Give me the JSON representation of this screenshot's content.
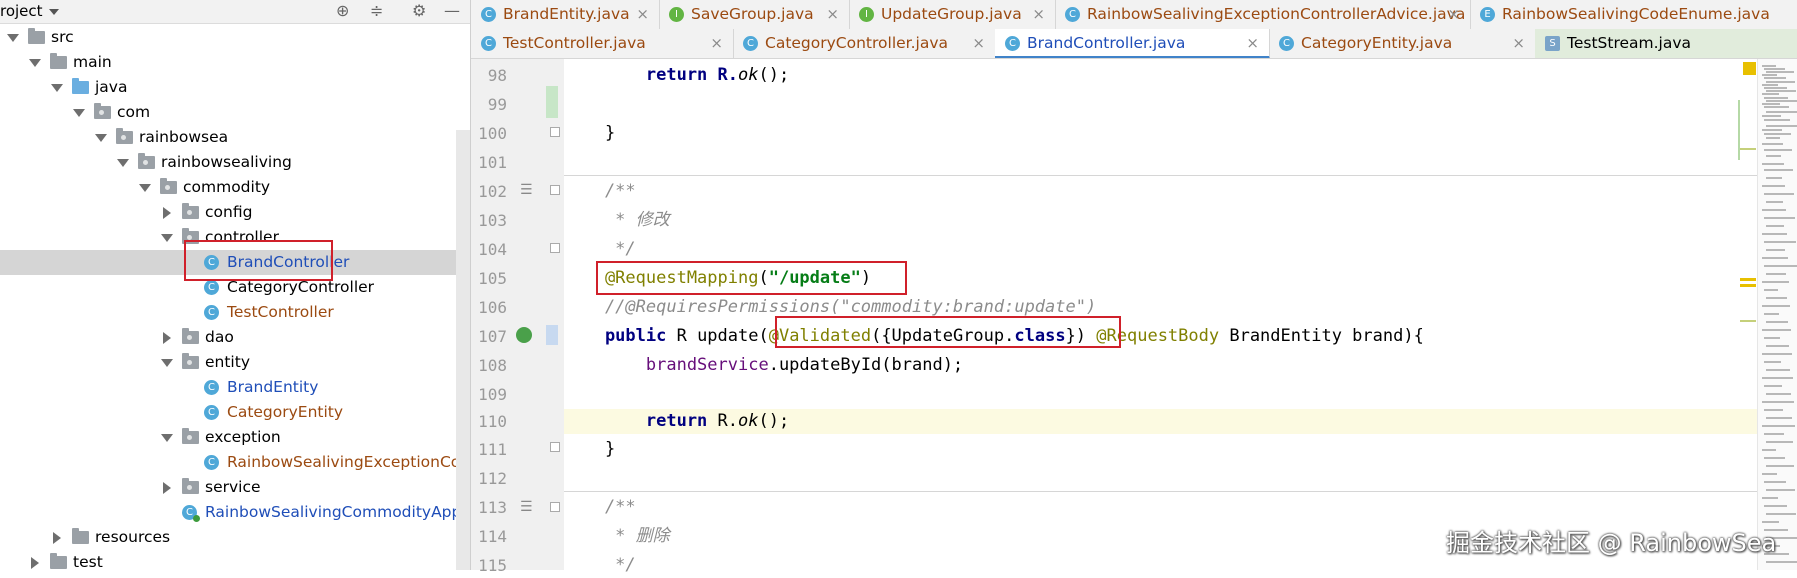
{
  "project": {
    "title": "roject",
    "tree": [
      {
        "label": "src",
        "kind": "folder-plain",
        "expanded": true
      },
      {
        "label": "main",
        "kind": "folder",
        "expanded": true
      },
      {
        "label": "java",
        "kind": "folder-blue",
        "expanded": true
      },
      {
        "label": "com",
        "kind": "package",
        "expanded": true
      },
      {
        "label": "rainbowsea",
        "kind": "package",
        "expanded": true
      },
      {
        "label": "rainbowsealiving",
        "kind": "package",
        "expanded": true
      },
      {
        "label": "commodity",
        "kind": "package",
        "expanded": true
      },
      {
        "label": "config",
        "kind": "package",
        "expanded": false
      },
      {
        "label": "controller",
        "kind": "package",
        "expanded": true
      },
      {
        "label": "BrandController",
        "kind": "class",
        "selected": true
      },
      {
        "label": "CategoryController",
        "kind": "class"
      },
      {
        "label": "TestController",
        "kind": "class"
      },
      {
        "label": "dao",
        "kind": "package",
        "expanded": false
      },
      {
        "label": "entity",
        "kind": "package",
        "expanded": true
      },
      {
        "label": "BrandEntity",
        "kind": "class"
      },
      {
        "label": "CategoryEntity",
        "kind": "class"
      },
      {
        "label": "exception",
        "kind": "package",
        "expanded": true
      },
      {
        "label": "RainbowSealivingExceptionContr",
        "kind": "class"
      },
      {
        "label": "service",
        "kind": "package",
        "expanded": false
      },
      {
        "label": "RainbowSealivingCommodityApplica",
        "kind": "class-app"
      },
      {
        "label": "resources",
        "kind": "folder-res",
        "expanded": false
      },
      {
        "label": "test",
        "kind": "folder",
        "expanded": false
      }
    ]
  },
  "tabs_row1": [
    {
      "label": "BrandEntity.java",
      "icon": "C"
    },
    {
      "label": "SaveGroup.java",
      "icon": "I"
    },
    {
      "label": "UpdateGroup.java",
      "icon": "I"
    },
    {
      "label": "RainbowSealivingExceptionControllerAdvice.java",
      "icon": "C"
    },
    {
      "label": "RainbowSealivingCodeEnume.java",
      "icon": "E"
    }
  ],
  "tabs_row2": [
    {
      "label": "TestController.java",
      "icon": "C"
    },
    {
      "label": "CategoryController.java",
      "icon": "C"
    },
    {
      "label": "BrandController.java",
      "icon": "C",
      "active": true
    },
    {
      "label": "CategoryEntity.java",
      "icon": "C"
    },
    {
      "label": "TestStream.java",
      "icon": "S"
    }
  ],
  "close_glyph": "×",
  "editor": {
    "lines": {
      "l98": {
        "num": "98",
        "t1": "        return R.",
        "t2": "ok",
        "t3": "();"
      },
      "l99": {
        "num": "99"
      },
      "l100": {
        "num": "100",
        "t1": "    }"
      },
      "l101": {
        "num": "101"
      },
      "l102": {
        "num": "102",
        "t1": "    /**"
      },
      "l103": {
        "num": "103",
        "t1": "     * 修改"
      },
      "l104": {
        "num": "104",
        "t1": "     */"
      },
      "l105": {
        "num": "105",
        "ann": "    @RequestMapping",
        "p1": "(",
        "str": "\"/update\"",
        "p2": ")"
      },
      "l106": {
        "num": "106",
        "t1": "    //@RequiresPermissions(\"commodity:brand:update\")"
      },
      "l107": {
        "num": "107",
        "kw1": "    public ",
        "p1": "R update(",
        "ann1": "@Validated",
        "p2": "({UpdateGroup.",
        "kw2": "class",
        "p3": "}) ",
        "ann2": "@RequestBody",
        "p4": " BrandEntity brand){"
      },
      "l108": {
        "num": "108",
        "fld": "        brandService",
        "p1": ".updateById(brand);"
      },
      "l109": {
        "num": "109"
      },
      "l110": {
        "num": "110",
        "kw": "        return ",
        "p1": "R.",
        "it": "ok",
        "p2": "();"
      },
      "l111": {
        "num": "111",
        "t1": "    }"
      },
      "l112": {
        "num": "112"
      },
      "l113": {
        "num": "113",
        "t1": "    /**"
      },
      "l114": {
        "num": "114",
        "t1": "     * 删除"
      },
      "l115": {
        "num": "115",
        "t1": "     */"
      }
    }
  },
  "watermark": "掘金技术社区 @ RainbowSea"
}
